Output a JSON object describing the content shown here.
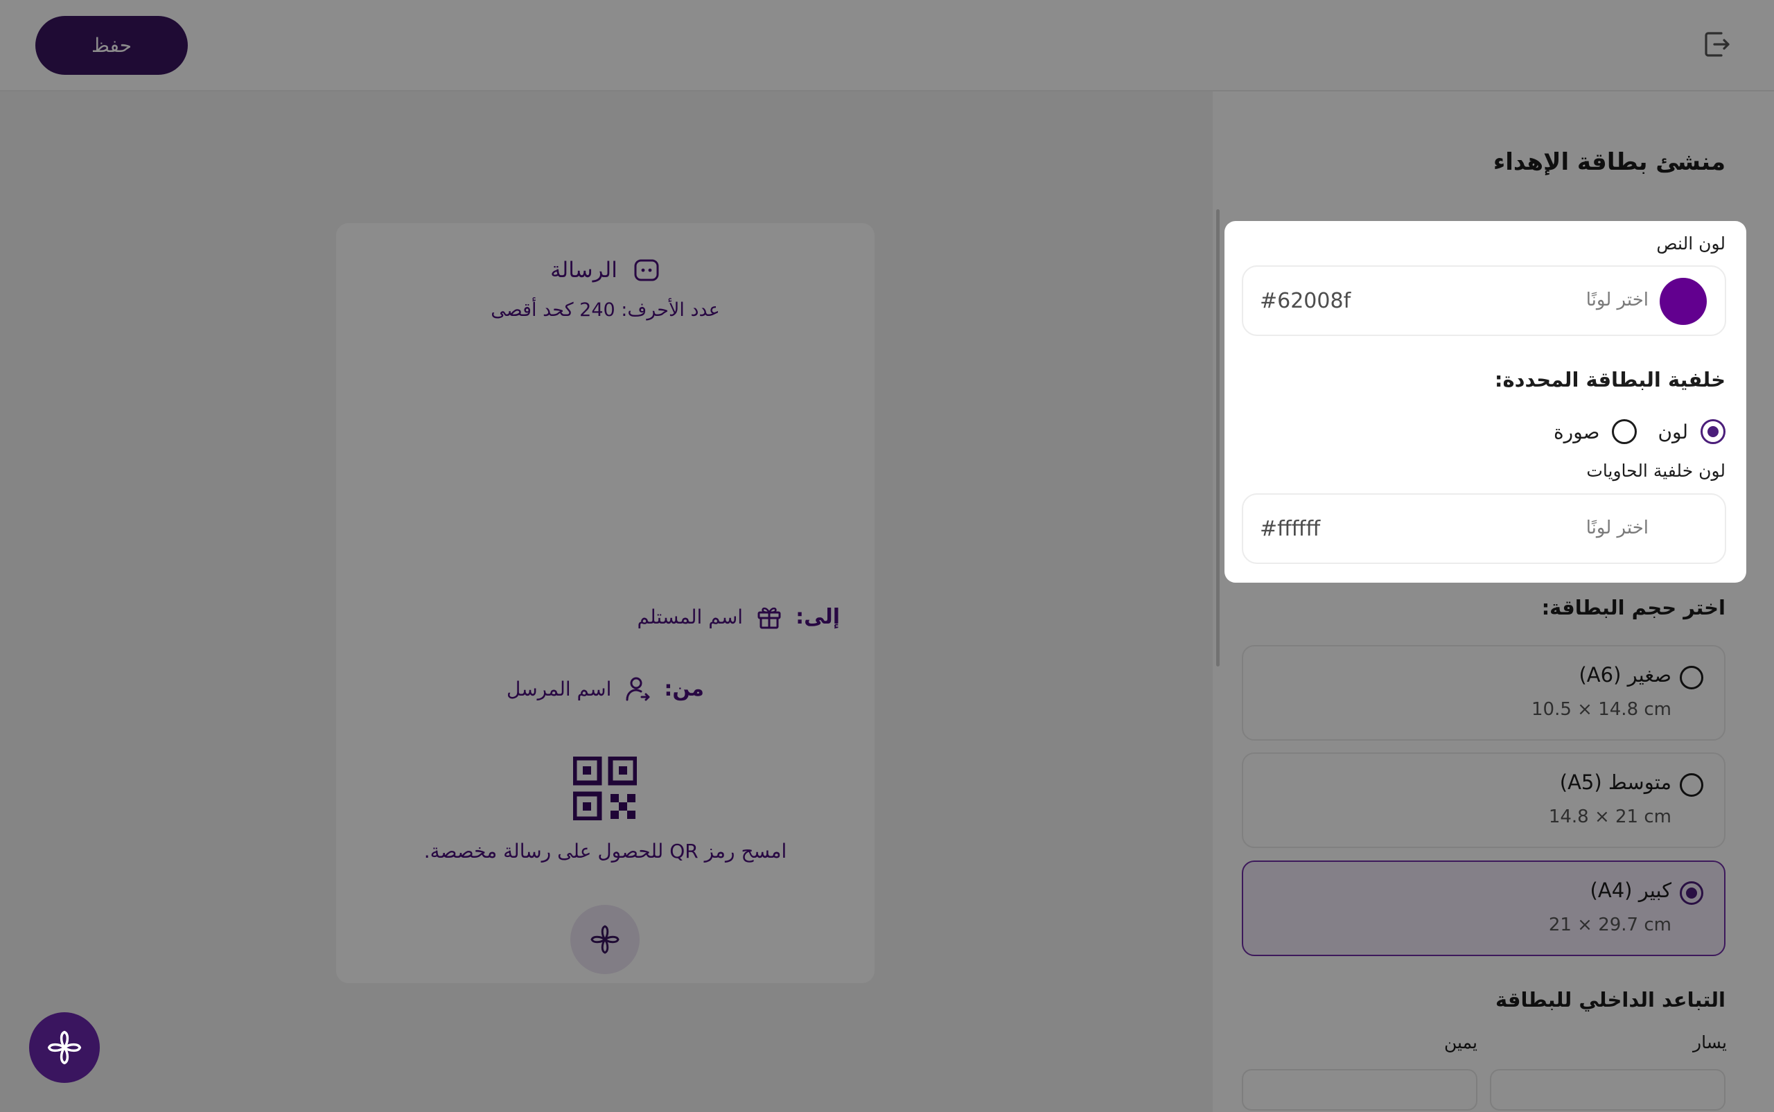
{
  "header": {
    "save_label": "حفظ"
  },
  "preview": {
    "message_title": "الرسالة",
    "char_limit": "عدد الأحرف: 240 كحد أقصى",
    "to_label": "إلى:",
    "to_value": "اسم المستلم",
    "from_label": "من:",
    "from_value": "اسم المرسل",
    "qr_caption": "امسح رمز QR للحصول على رسالة مخصصة."
  },
  "sidebar": {
    "title": "منشئ بطاقة الإهداء",
    "size_title": "اختر حجم البطاقة:",
    "sizes": [
      {
        "label": "صغير (A6)",
        "dims": "10.5 × 14.8 cm",
        "selected": false
      },
      {
        "label": "متوسط (A5)",
        "dims": "14.8 × 21 cm",
        "selected": false
      },
      {
        "label": "كبير (A4)",
        "dims": "21 × 29.7 cm",
        "selected": true
      }
    ],
    "padding_title": "التباعد الداخلي للبطاقة",
    "padding_left": "يسار",
    "padding_right": "يمين"
  },
  "popup": {
    "text_color_label": "لون النص",
    "pick_color": "اختر لونًا",
    "text_color_hex": "#62008f",
    "text_color": "#62008f",
    "bg_title": "خلفية البطاقة المحددة:",
    "bg_option_color": "لون",
    "bg_option_image": "صورة",
    "container_bg_label": "لون خلفية الحاويات",
    "container_bg_hex": "#ffffff"
  },
  "colors": {
    "accent": "#3a155f",
    "purple_text": "#4a0f7a"
  }
}
